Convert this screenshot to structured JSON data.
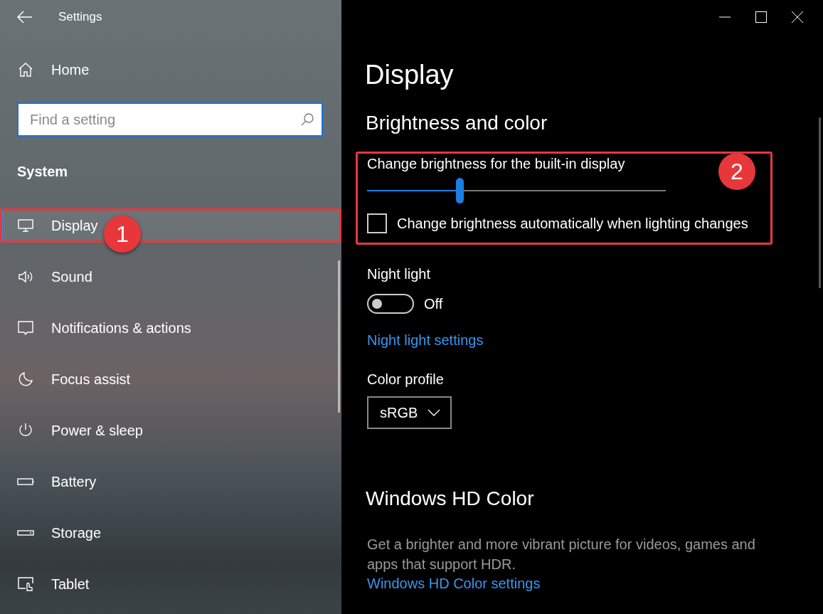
{
  "window": {
    "title": "Settings"
  },
  "sidebar": {
    "home": "Home",
    "search": {
      "placeholder": "Find a setting"
    },
    "section": "System",
    "items": [
      {
        "kind": "display",
        "label": "Display",
        "selected": true,
        "callout": "1"
      },
      {
        "kind": "sound",
        "label": "Sound",
        "selected": false
      },
      {
        "kind": "notifications",
        "label": "Notifications & actions",
        "selected": false
      },
      {
        "kind": "focus",
        "label": "Focus assist",
        "selected": false
      },
      {
        "kind": "power",
        "label": "Power & sleep",
        "selected": false
      },
      {
        "kind": "battery",
        "label": "Battery",
        "selected": false
      },
      {
        "kind": "storage",
        "label": "Storage",
        "selected": false
      },
      {
        "kind": "tablet",
        "label": "Tablet",
        "selected": false
      }
    ]
  },
  "page": {
    "title": "Display",
    "section": "Brightness and color",
    "brightness": {
      "callout": "2",
      "label": "Change brightness for the built-in display",
      "level": 0.31,
      "auto": {
        "label": "Change brightness automatically when lighting changes",
        "checked": false
      }
    },
    "night_light": {
      "label": "Night light",
      "on": false,
      "state": "Off",
      "link": "Night light settings"
    },
    "color_profile": {
      "label": "Color profile",
      "value": "sRGB"
    },
    "hd_color": {
      "title": "Windows HD Color",
      "description": "Get a brighter and more vibrant picture for videos, games and apps that support HDR.",
      "link": "Windows HD Color settings"
    }
  }
}
